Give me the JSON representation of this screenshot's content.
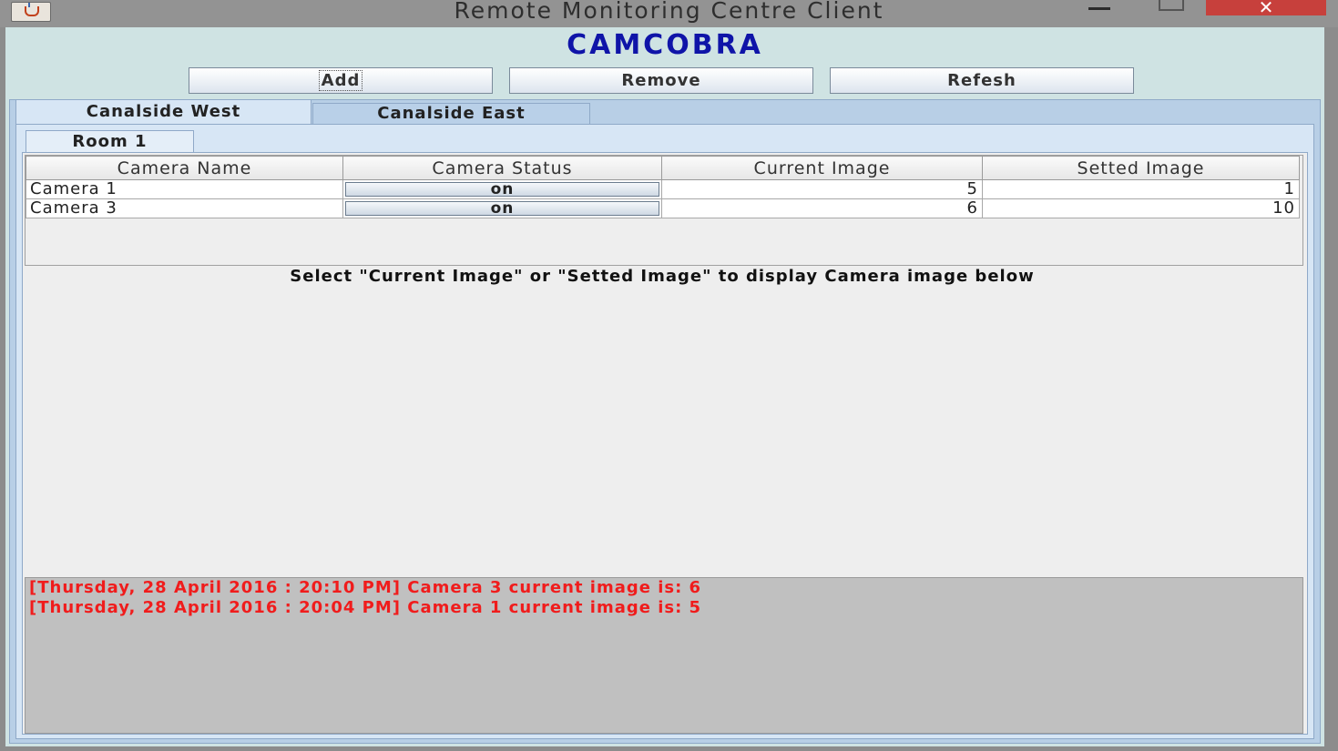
{
  "window": {
    "title": "Remote Monitoring Centre Client",
    "close_glyph": "✕"
  },
  "brand": "CAMCOBRA",
  "toolbar": {
    "add_label": "Add",
    "remove_label": "Remove",
    "refresh_label": "Refesh"
  },
  "sites": {
    "tabs": [
      {
        "label": "Canalside West",
        "selected": true
      },
      {
        "label": "Canalside East",
        "selected": false
      }
    ]
  },
  "rooms": {
    "tabs": [
      {
        "label": "Room 1",
        "selected": true
      }
    ]
  },
  "table": {
    "columns": [
      "Camera Name",
      "Camera Status",
      "Current Image",
      "Setted Image"
    ],
    "rows": [
      {
        "name": "Camera 1",
        "status": "on",
        "current": "5",
        "setted": "1"
      },
      {
        "name": "Camera 3",
        "status": "on",
        "current": "6",
        "setted": "10"
      }
    ]
  },
  "hint": "Select \"Current Image\" or \"Setted Image\" to display Camera image below",
  "log": {
    "lines": [
      "[Thursday, 28 April 2016 : 20:10 PM] Camera 3 current image is: 6",
      "[Thursday, 28 April 2016 : 20:04 PM] Camera 1 current image is: 5"
    ]
  },
  "colors": {
    "brand": "#0f14a8",
    "log_text": "#f01c1c",
    "close_button": "#c7403c"
  },
  "icons": [
    "java-app-icon",
    "minimize-icon",
    "maximize-icon",
    "close-icon"
  ]
}
